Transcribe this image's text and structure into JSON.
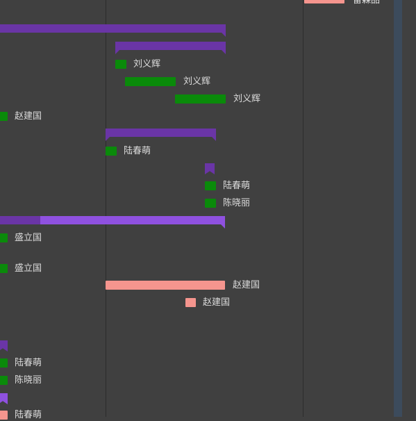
{
  "colors": {
    "background": "#404040",
    "summary": "#6a35a6",
    "summary_light": "#8f51e0",
    "task_green": "#0a8a0a",
    "task_salmon": "#f5958e",
    "side_column": "#3c4b5c"
  },
  "rows": [
    {
      "name": "雷森品"
    },
    {
      "name": "刘义辉"
    },
    {
      "name": "刘义辉"
    },
    {
      "name": "刘义辉"
    },
    {
      "name": "赵建国"
    },
    {
      "name": "陆春萌"
    },
    {
      "name": "陆春萌"
    },
    {
      "name": "陈晓丽"
    },
    {
      "name": "盛立国"
    },
    {
      "name": "盛立国"
    },
    {
      "name": "赵建国"
    },
    {
      "name": "赵建国"
    },
    {
      "name": "陆春萌"
    },
    {
      "name": "陈晓丽"
    },
    {
      "name": "陆春萌"
    }
  ]
}
